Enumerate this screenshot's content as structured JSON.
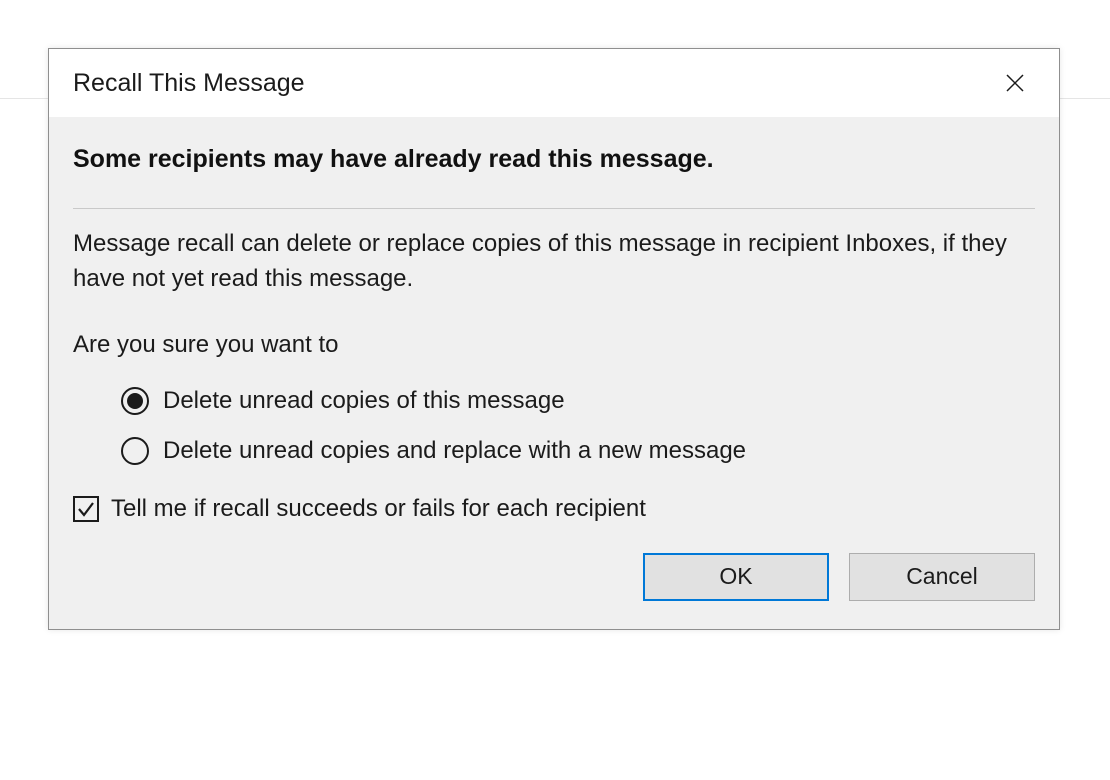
{
  "title": "Recall This Message",
  "headline": "Some recipients may have already read this message.",
  "description": "Message recall can delete or replace copies of this message in recipient Inboxes, if they have not yet read this message.",
  "prompt": "Are you sure you want to",
  "options": {
    "delete": {
      "label": "Delete unread copies of this message",
      "selected": true
    },
    "replace": {
      "label": "Delete unread copies and replace with a new message",
      "selected": false
    }
  },
  "checkbox": {
    "label": "Tell me if recall succeeds or fails for each recipient",
    "checked": true
  },
  "buttons": {
    "ok": "OK",
    "cancel": "Cancel"
  }
}
